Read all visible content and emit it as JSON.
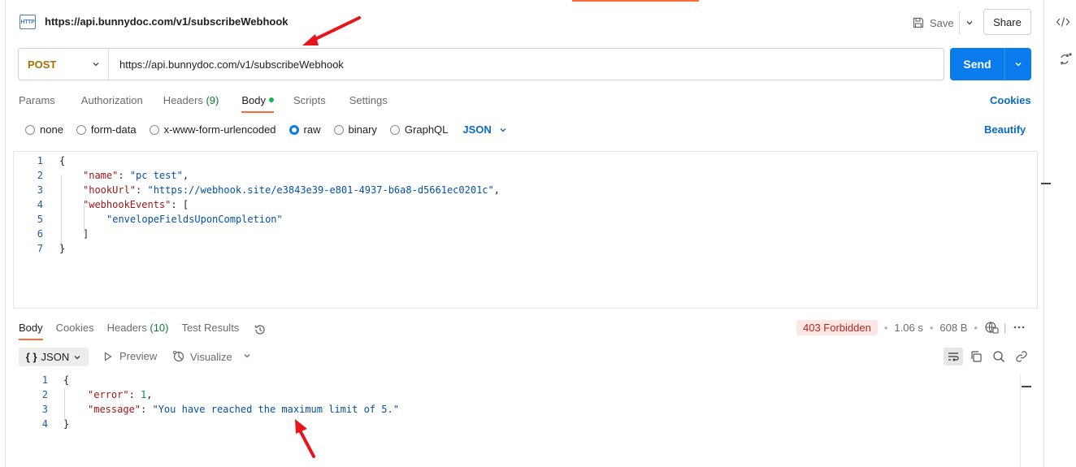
{
  "header": {
    "icon_label": "HTTP",
    "title": "https://api.bunnydoc.com/v1/subscribeWebhook",
    "save_label": "Save",
    "share_label": "Share"
  },
  "request": {
    "method": "POST",
    "url": "https://api.bunnydoc.com/v1/subscribeWebhook",
    "send_label": "Send"
  },
  "request_tabs": [
    {
      "label": "Params"
    },
    {
      "label": "Authorization"
    },
    {
      "label": "Headers",
      "count": "(9)"
    },
    {
      "label": "Body",
      "active": true
    },
    {
      "label": "Scripts"
    },
    {
      "label": "Settings"
    }
  ],
  "cookies_label": "Cookies",
  "body_types": [
    "none",
    "form-data",
    "x-www-form-urlencoded",
    "raw",
    "binary",
    "GraphQL"
  ],
  "selected_body_type": "raw",
  "format_label": "JSON",
  "beautify_label": "Beautify",
  "request_body": {
    "line_numbers": [
      "1",
      "2",
      "3",
      "4",
      "5",
      "6",
      "7"
    ],
    "open_brace": "{",
    "name_key": "\"name\"",
    "name_val": "\"pc test\"",
    "hook_key": "\"hookUrl\"",
    "hook_val": "\"https://webhook.site/e3843e39-e801-4937-b6a8-d5661ec0201c\"",
    "events_key": "\"webhookEvents\"",
    "events_open": "[",
    "event_item": "\"envelopeFieldsUponCompletion\"",
    "events_close": "]",
    "close_brace": "}"
  },
  "response_tabs": [
    {
      "label": "Body",
      "active": true
    },
    {
      "label": "Cookies"
    },
    {
      "label": "Headers",
      "count": "(10)"
    },
    {
      "label": "Test Results"
    }
  ],
  "response_meta": {
    "status": "403 Forbidden",
    "status_color": "#b3261e",
    "time": "1.06 s",
    "size": "608 B"
  },
  "response_toolbar": {
    "format_label": "JSON",
    "format_icon": "{ }",
    "preview_label": "Preview",
    "visualize_label": "Visualize"
  },
  "response_body": {
    "line_numbers": [
      "1",
      "2",
      "3",
      "4"
    ],
    "open_brace": "{",
    "error_key": "\"error\"",
    "error_val": "1",
    "message_key": "\"message\"",
    "message_val": "\"You have reached the maximum limit of 5.\"",
    "close_brace": "}"
  },
  "colors": {
    "accent": "#ff6c37",
    "send_button": "#097bed",
    "method": "#a66d00",
    "link": "#0a6ac9",
    "annotation_arrow": "#e8141c"
  }
}
